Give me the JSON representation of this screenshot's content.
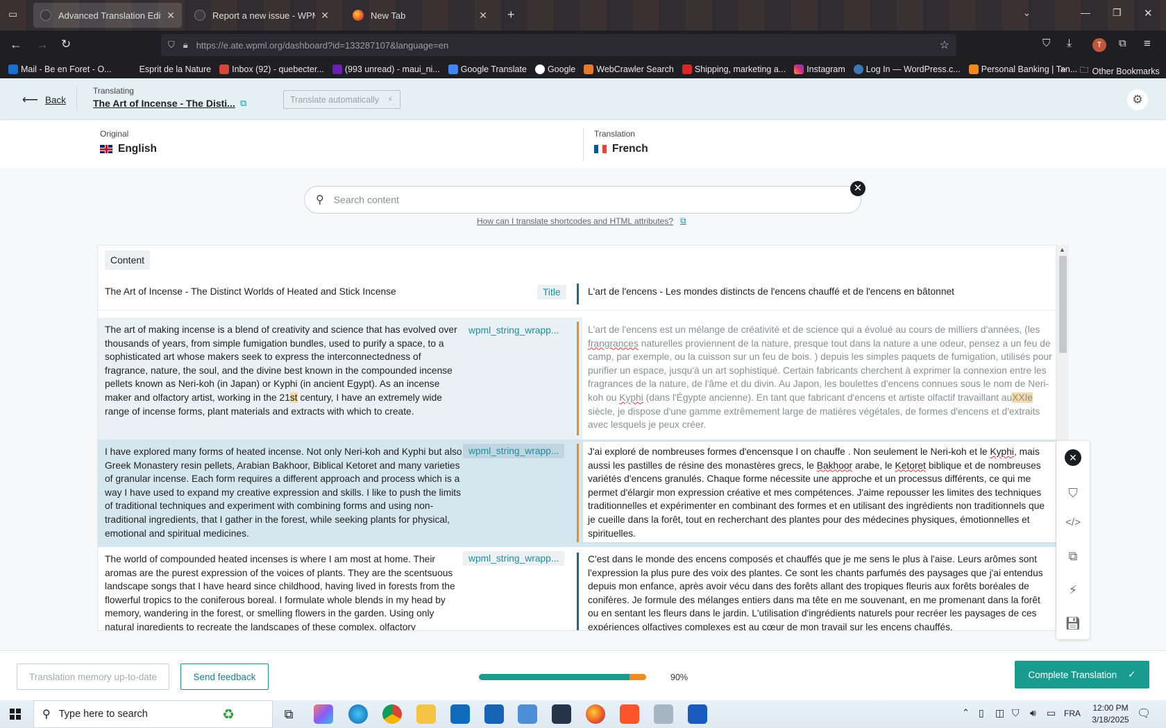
{
  "browser": {
    "tabs": [
      {
        "title": "Advanced Translation Editor - WPML"
      },
      {
        "title": "Report a new issue - WPML"
      },
      {
        "title": "New Tab"
      }
    ],
    "url": "https://e.ate.wpml.org/dashboard?id=133287107&language=en",
    "bookmarks": [
      "Mail - Be en Foret - O...",
      "Esprit de la Nature",
      "Inbox (92) - quebecter...",
      "(993 unread) - maui_ni...",
      "Google Translate",
      "Google",
      "WebCrawler Search",
      "Shipping, marketing a...",
      "Instagram",
      "Log In — WordPress.c...",
      "Personal Banking | Tan..."
    ],
    "other_bookmarks": "Other Bookmarks",
    "profile_initial": "T"
  },
  "header": {
    "back_label": "Back",
    "translating_label": "Translating",
    "doc_title": "The Art of Incense - The Disti...",
    "translate_auto_label": "Translate automatically"
  },
  "languages": {
    "original_label": "Original",
    "original": "English",
    "translation_label": "Translation",
    "translation": "French"
  },
  "search": {
    "placeholder": "Search content",
    "help_link": "How can I translate shortcodes and HTML attributes?"
  },
  "table": {
    "section_label": "Content",
    "rows": [
      {
        "source": "The Art of Incense - The Distinct Worlds of Heated and Stick Incense",
        "tag": "Title",
        "target": "L'art de l'encens - Les mondes distincts de l'encens chauffé et de l'encens en bâtonnet"
      },
      {
        "source_a": "The art of making incense is a blend of creativity and science that has evolved over thousands of years, from simple fumigation bundles, used to purify a space, to a sophisticated art whose makers seek to express the interconnectedness of fragrance, nature, the soul, and the divine best known in the compounded incense pellets known as Neri-koh (in Japan) or Kyphi (in ancient Egypt). As an incense maker and olfactory artist, working in the 21",
        "source_hl": "st",
        "source_b": " century, I have an extremely wide range of incense forms, plant materials and extracts with which to create.",
        "tag": "wpml_string_wrapp...",
        "target_a": "L'art de l'encens est un mélange de créativité et de science qui a évolué au cours de milliers d'années, (les ",
        "target_sq1": "frangrances",
        "target_b": " naturelles proviennent de la nature, presque tout dans la nature a une odeur, pensez a un feu de camp, par exemple, ou la cuisson sur un feu de bois. ) depuis les simples paquets de fumigation, utilisés pour purifier un espace, jusqu'à un art sophistiqué. Certain fabricants cherchent à exprimer la connexion entre les fragrances de la nature, de l'âme et du divin. Au Japon, les boulettes d'encens connues sous le nom de Neri-koh ou ",
        "target_sq2": "Kyphi",
        "target_c": " (dans l'Égypte ancienne). En tant que fabricant d'encens et artiste olfactif travaillant au",
        "target_hl": "XXIe",
        "target_d": " siècle, je dispose d'une gamme extrêmement large de matières végétales, de formes d'encens et d'extraits avec lesquels je peux créer."
      },
      {
        "source": "I have explored many forms of heated incense. Not only Neri-koh and Kyphi but also Greek Monastery resin pellets, Arabian Bakhoor, Biblical Ketoret and many varieties of granular incense. Each form requires a different approach and process which is a way I have used to expand my creative expression and skills. I like to push the limits of traditional techniques and experiment with combining forms and using non-traditional ingredients, that I gather in the forest, while seeking plants for physical, emotional and spiritual medicines.",
        "tag": "wpml_string_wrapp...",
        "target_a": "J'ai exploré de nombreuses formes d'encensque l on chauffe . Non seulement le Neri-koh et le ",
        "target_sq1": "Kyphi",
        "target_b": ", mais aussi les pastilles de résine des monastères grecs, le ",
        "target_sq2": "Bakhoor",
        "target_c": " arabe, le ",
        "target_sq3": "Ketoret",
        "target_d": " biblique et de nombreuses variétés d'encens granulés. Chaque forme nécessite une approche et un processus différents, ce qui me permet d'élargir mon expression créative et mes compétences. J'aime repousser les limites des techniques traditionnelles et expérimenter en combinant des formes et en utilisant des ingrédients non traditionnels que je cueille dans la forêt, tout en recherchant des plantes pour des médecines physiques, émotionnelles et spirituelles."
      },
      {
        "source": "The world of compounded heated incenses is where I am most at home. Their aromas are the purest expression of the voices of plants. They are the scentsuous landscape songs that I have heard since childhood, having lived in forests from the flowerful tropics to the coniferous boreal. I formulate whole blends in my head by memory, wandering in the forest, or smelling flowers in the garden. Using only natural ingredients to recreate the landscapes of these complex, olfactory",
        "tag": "wpml_string_wrapp...",
        "target": "C'est dans le monde des encens composés et chauffés que je me sens le plus à l'aise. Leurs arômes sont l'expression la plus pure des voix des plantes. Ce sont les chants parfumés des paysages que j'ai entendus depuis mon enfance, après avoir vécu dans des forêts allant des tropiques fleuris aux forêts boréales de conifères. Je formule des mélanges entiers dans ma tête en me souvenant, en me promenant dans la forêt ou en sentant les fleurs dans le jardin. L'utilisation d'ingrédients naturels pour recréer les paysages de ces expériences olfactives complexes est au cœur de mon travail sur les encens chauffés."
      }
    ]
  },
  "footer": {
    "tm_label": "Translation memory up-to-date",
    "feedback_label": "Send feedback",
    "progress_percent": 90,
    "progress_label": "90%",
    "complete_label": "Complete Translation"
  },
  "taskbar": {
    "search_placeholder": "Type here to search",
    "lang": "FRA",
    "time": "12:00 PM",
    "date": "3/18/2025"
  },
  "colors": {
    "accent": "#1a9b8f",
    "progress": "#1c9a8e",
    "progress_tail": "#f08a24",
    "row_active": "#d4e6ee",
    "bar_orange": "#f08a24",
    "bar_teal": "#1c6c86"
  }
}
